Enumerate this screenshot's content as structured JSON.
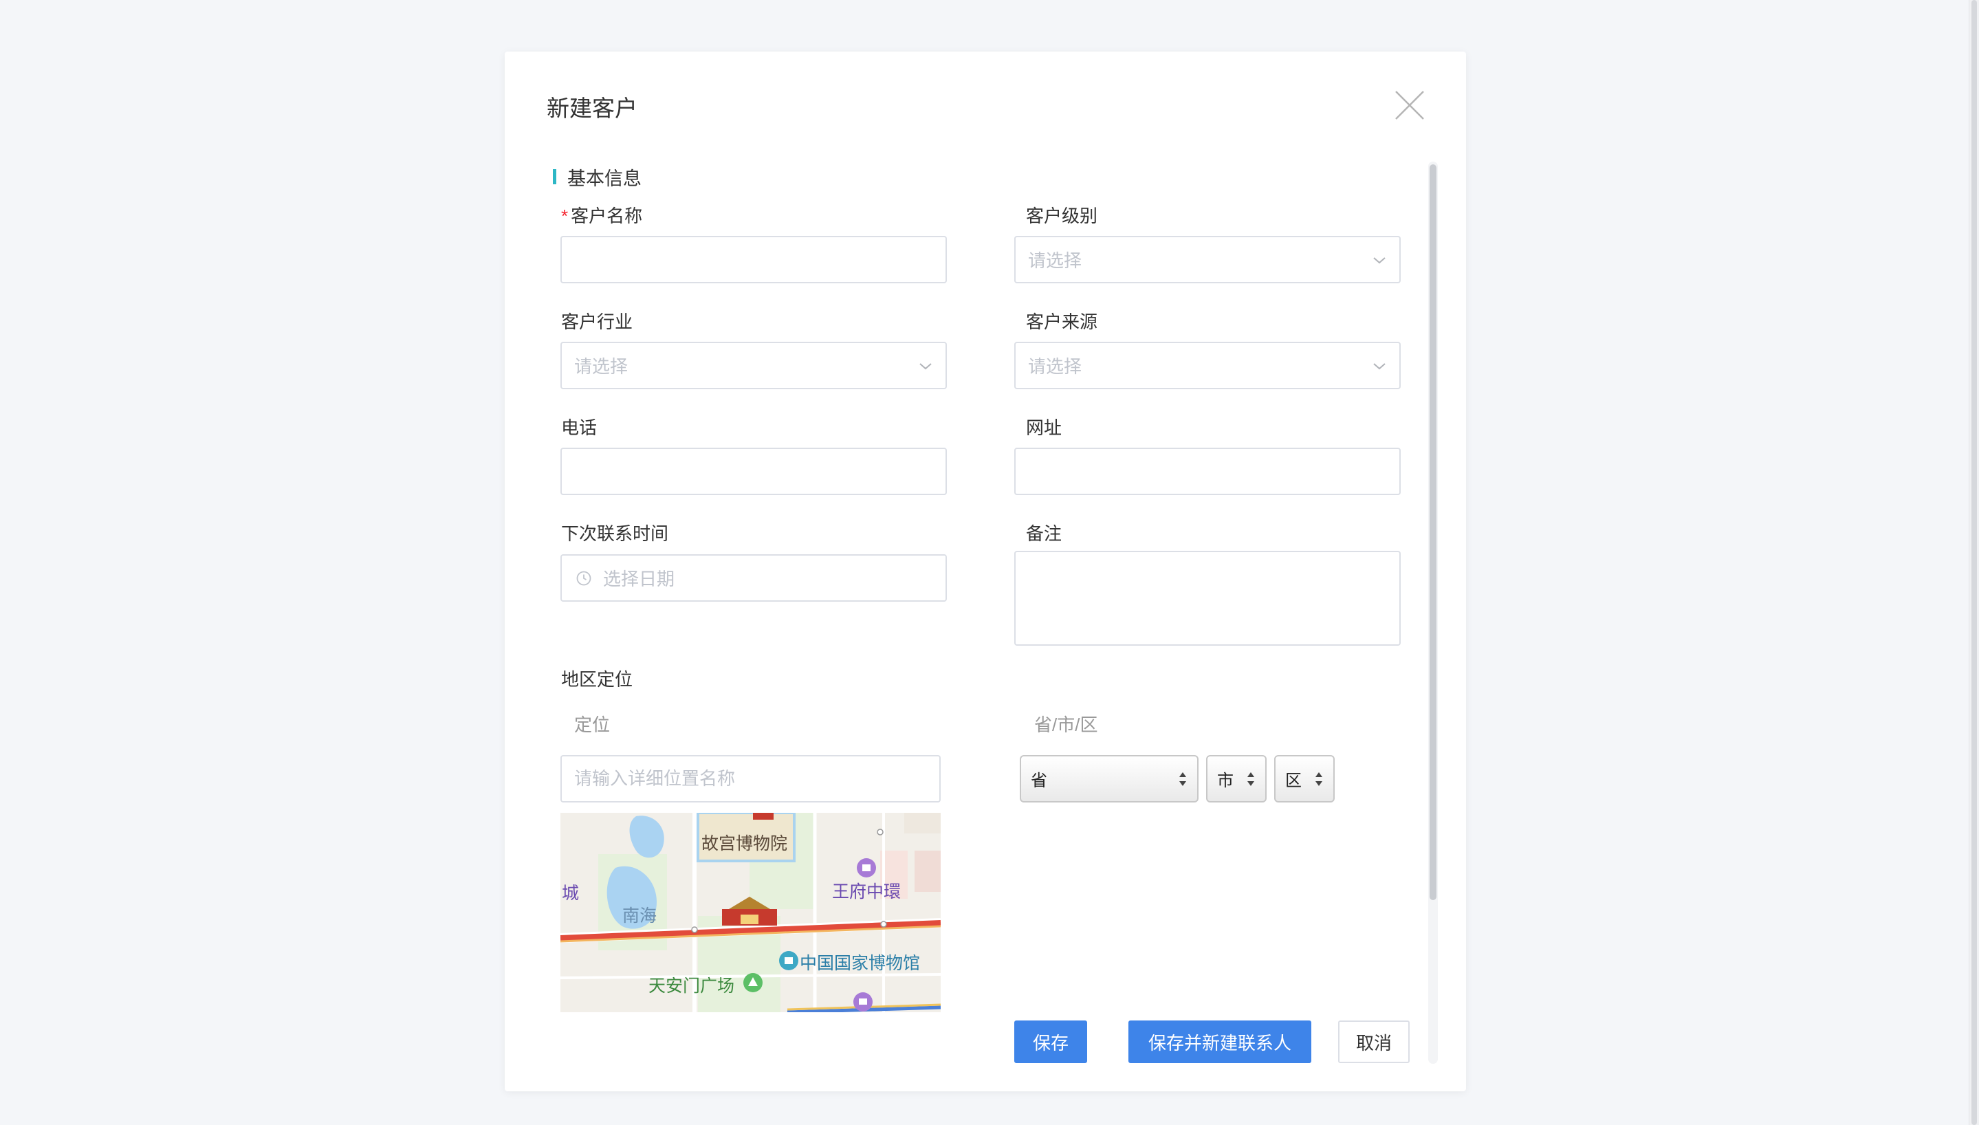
{
  "dialog": {
    "title": "新建客户",
    "section_title": "基本信息"
  },
  "form": {
    "customer_name": {
      "label": "客户名称",
      "required_mark": "*",
      "value": ""
    },
    "customer_level": {
      "label": "客户级别",
      "placeholder": "请选择"
    },
    "customer_industry": {
      "label": "客户行业",
      "placeholder": "请选择"
    },
    "customer_source": {
      "label": "客户来源",
      "placeholder": "请选择"
    },
    "phone": {
      "label": "电话",
      "value": ""
    },
    "website": {
      "label": "网址",
      "value": ""
    },
    "next_contact_time": {
      "label": "下次联系时间",
      "placeholder": "选择日期"
    },
    "remark": {
      "label": "备注",
      "value": ""
    },
    "region": {
      "label": "地区定位",
      "location_label": "定位",
      "location_placeholder": "请输入详细位置名称",
      "pcd_label": "省/市/区",
      "province": "省",
      "city": "市",
      "district": "区"
    }
  },
  "map": {
    "labels": {
      "palace_museum": "故宫博物院",
      "wangfujing": "王府中環",
      "nanhai": "南海",
      "cheng": "城",
      "national_museum": "中国国家博物馆",
      "tiananmen_square": "天安门广场"
    }
  },
  "buttons": {
    "save": "保存",
    "save_and_new_contact": "保存并新建联系人",
    "cancel": "取消"
  },
  "colors": {
    "primary": "#3e84e9",
    "accent_bar": "#2db7c5",
    "required": "#f5222d",
    "border": "#dcdfe6",
    "placeholder": "#c0c4cc"
  }
}
